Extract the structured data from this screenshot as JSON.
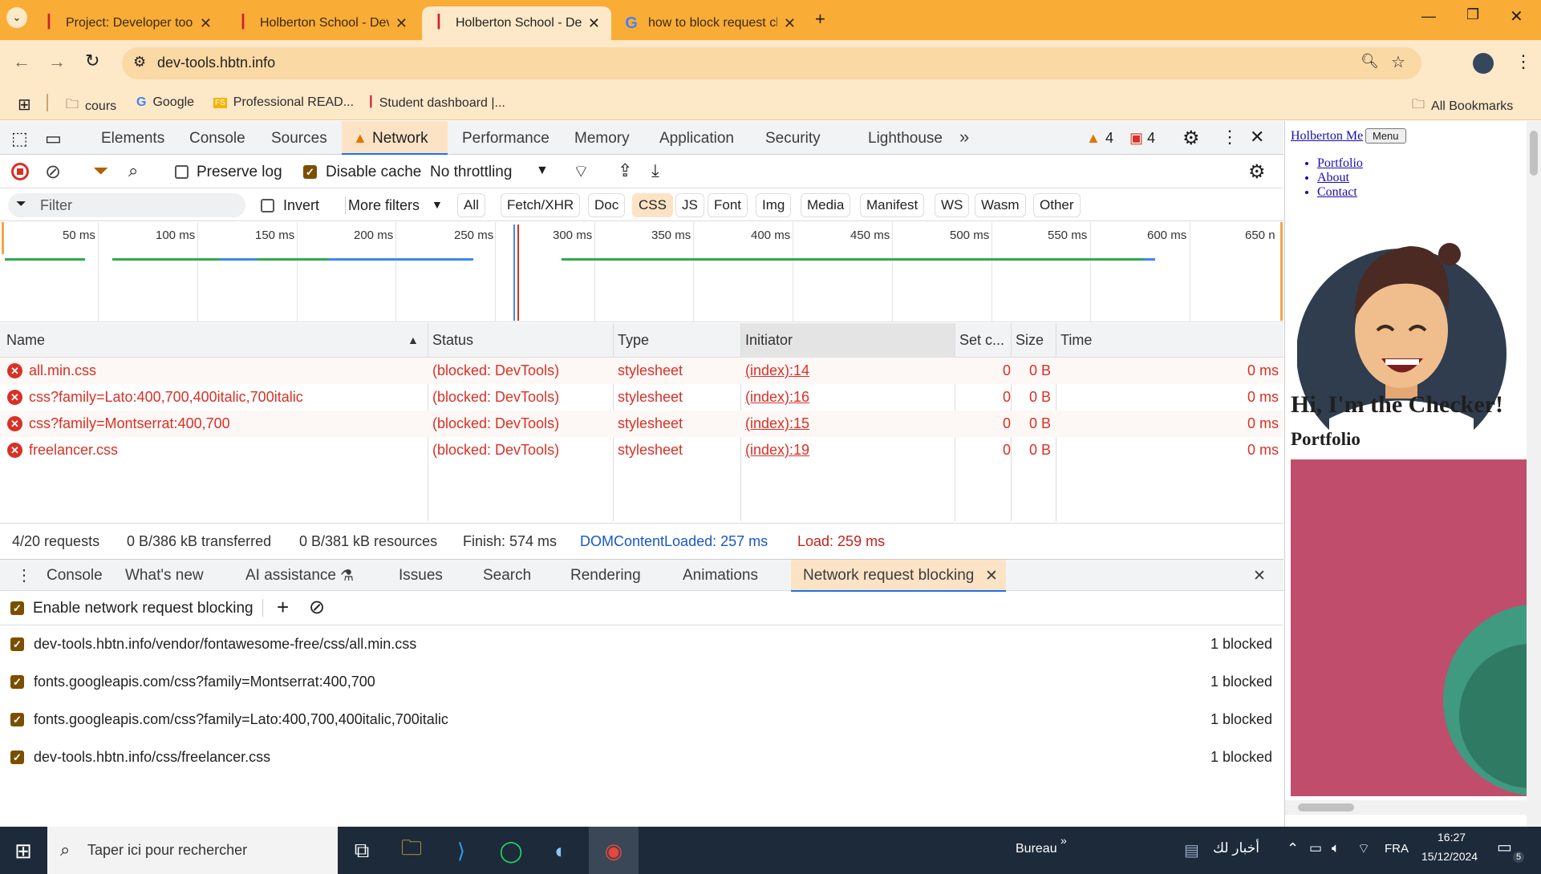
{
  "browser": {
    "tabs": [
      {
        "title": "Project: Developer tools | Holbe",
        "active": false
      },
      {
        "title": "Holberton School - Developer t",
        "active": false
      },
      {
        "title": "Holberton School - Developer t",
        "active": true
      },
      {
        "title": "how to block request chrome d",
        "active": false
      }
    ],
    "url": "dev-tools.hbtn.info",
    "bookmarks": [
      "cours",
      "Google",
      "Professional READ...",
      "Student dashboard |..."
    ],
    "all_bookmarks": "All Bookmarks"
  },
  "devtools": {
    "tabs": [
      "Elements",
      "Console",
      "Sources",
      "Network",
      "Performance",
      "Memory",
      "Application",
      "Security",
      "Lighthouse"
    ],
    "more_tabs": "»",
    "warnings_count": "4",
    "errors_count": "4",
    "network_toolbar": {
      "preserve_log": "Preserve log",
      "preserve_log_checked": false,
      "disable_cache": "Disable cache",
      "disable_cache_checked": true,
      "throttling": "No throttling"
    },
    "filter": {
      "placeholder": "Filter",
      "invert": "Invert",
      "more_filters": "More filters",
      "types": [
        "All",
        "Fetch/XHR",
        "Doc",
        "CSS",
        "JS",
        "Font",
        "Img",
        "Media",
        "Manifest",
        "WS",
        "Wasm",
        "Other"
      ],
      "selected_type": "CSS"
    },
    "timeline_ticks": [
      "50 ms",
      "100 ms",
      "150 ms",
      "200 ms",
      "250 ms",
      "300 ms",
      "350 ms",
      "400 ms",
      "450 ms",
      "500 ms",
      "550 ms",
      "600 ms",
      "650 n"
    ],
    "table": {
      "headers": [
        "Name",
        "Status",
        "Type",
        "Initiator",
        "Set c...",
        "Size",
        "Time"
      ],
      "rows": [
        {
          "name": "all.min.css",
          "status": "(blocked: DevTools)",
          "type": "stylesheet",
          "initiator": "(index):14",
          "set_cookies": "0",
          "size": "0 B",
          "time": "0 ms"
        },
        {
          "name": "css?family=Lato:400,700,400italic,700italic",
          "status": "(blocked: DevTools)",
          "type": "stylesheet",
          "initiator": "(index):16",
          "set_cookies": "0",
          "size": "0 B",
          "time": "0 ms"
        },
        {
          "name": "css?family=Montserrat:400,700",
          "status": "(blocked: DevTools)",
          "type": "stylesheet",
          "initiator": "(index):15",
          "set_cookies": "0",
          "size": "0 B",
          "time": "0 ms"
        },
        {
          "name": "freelancer.css",
          "status": "(blocked: DevTools)",
          "type": "stylesheet",
          "initiator": "(index):19",
          "set_cookies": "0",
          "size": "0 B",
          "time": "0 ms"
        }
      ]
    },
    "status": {
      "requests": "4/20 requests",
      "transferred": "0 B/386 kB transferred",
      "resources": "0 B/381 kB resources",
      "finish": "Finish: 574 ms",
      "dom_loaded": "DOMContentLoaded: 257 ms",
      "load": "Load: 259 ms"
    },
    "drawer": {
      "tabs": [
        "Console",
        "What's new",
        "AI assistance",
        "Issues",
        "Search",
        "Rendering",
        "Animations",
        "Network request blocking"
      ],
      "active_tab": "Network request blocking",
      "enable_label": "Enable network request blocking",
      "patterns": [
        {
          "url": "dev-tools.hbtn.info/vendor/fontawesome-free/css/all.min.css",
          "count": "1 blocked"
        },
        {
          "url": "fonts.googleapis.com/css?family=Montserrat:400,700",
          "count": "1 blocked"
        },
        {
          "url": "fonts.googleapis.com/css?family=Lato:400,700,400italic,700italic",
          "count": "1 blocked"
        },
        {
          "url": "dev-tools.hbtn.info/css/freelancer.css",
          "count": "1 blocked"
        }
      ]
    }
  },
  "page": {
    "brand": "Holberton Me",
    "menu": "Menu",
    "nav": [
      "Portfolio",
      "About",
      "Contact"
    ],
    "heading": "Hi, I'm the Checker!",
    "subheading": "Portfolio"
  },
  "taskbar": {
    "search_placeholder": "Taper ici pour rechercher",
    "desktop": "Bureau",
    "news": "أخبار لك",
    "lang": "FRA",
    "time": "16:27",
    "date": "15/12/2024",
    "notifications": "5"
  },
  "colors": {
    "accent": "#f9ac36",
    "error": "#d93025",
    "devtools_tab_active": "#1a73e8"
  }
}
